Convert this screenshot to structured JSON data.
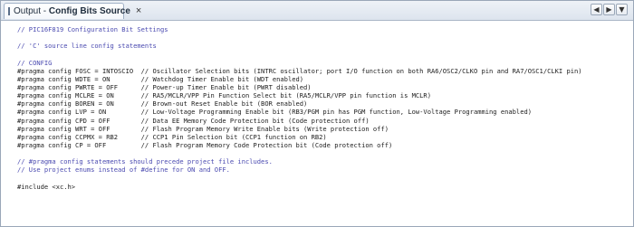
{
  "tab": {
    "prefix": "Output - ",
    "title": "Config Bits Source",
    "close_label": "×"
  },
  "nav": {
    "prev_icon": "◀",
    "next_icon": "▶",
    "menu_icon": "▼"
  },
  "code_lines": [
    "// PIC16F819 Configuration Bit Settings",
    "",
    "// 'C' source line config statements",
    "",
    "// CONFIG",
    "#pragma config FOSC = INTOSCIO  // Oscillator Selection bits (INTRC oscillator; port I/O function on both RA6/OSC2/CLKO pin and RA7/OSC1/CLKI pin)",
    "#pragma config WDTE = ON        // Watchdog Timer Enable bit (WDT enabled)",
    "#pragma config PWRTE = OFF      // Power-up Timer Enable bit (PWRT disabled)",
    "#pragma config MCLRE = ON       // RA5/MCLR/VPP Pin Function Select bit (RA5/MCLR/VPP pin function is MCLR)",
    "#pragma config BOREN = ON       // Brown-out Reset Enable bit (BOR enabled)",
    "#pragma config LVP = ON         // Low-Voltage Programming Enable bit (RB3/PGM pin has PGM function, Low-Voltage Programming enabled)",
    "#pragma config CPD = OFF        // Data EE Memory Code Protection bit (Code protection off)",
    "#pragma config WRT = OFF        // Flash Program Memory Write Enable bits (Write protection off)",
    "#pragma config CCPMX = RB2      // CCP1 Pin Selection bit (CCP1 function on RB2)",
    "#pragma config CP = OFF         // Flash Program Memory Code Protection bit (Code protection off)",
    "",
    "// #pragma config statements should precede project file includes.",
    "// Use project enums instead of #define for ON and OFF.",
    "",
    "#include <xc.h>"
  ]
}
